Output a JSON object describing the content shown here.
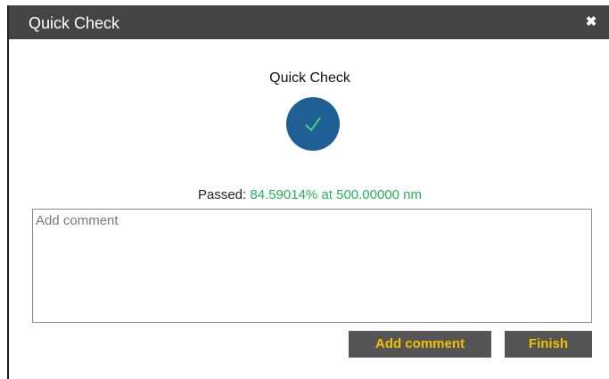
{
  "dialog": {
    "title": "Quick Check",
    "close_icon": "close-icon"
  },
  "main": {
    "heading": "Quick Check",
    "status_icon": "checkmark-icon",
    "result_label": "Passed:",
    "result_value": "84.59014% at 500.00000 nm"
  },
  "comment": {
    "placeholder": "Add comment",
    "value": ""
  },
  "buttons": {
    "add_comment": "Add comment",
    "finish": "Finish"
  },
  "colors": {
    "titlebar": "#444444",
    "status_circle": "#1f5f96",
    "checkmark": "#3fd27a",
    "result_value": "#22b35a",
    "button_bg": "#555555",
    "button_text": "#f2c000"
  }
}
